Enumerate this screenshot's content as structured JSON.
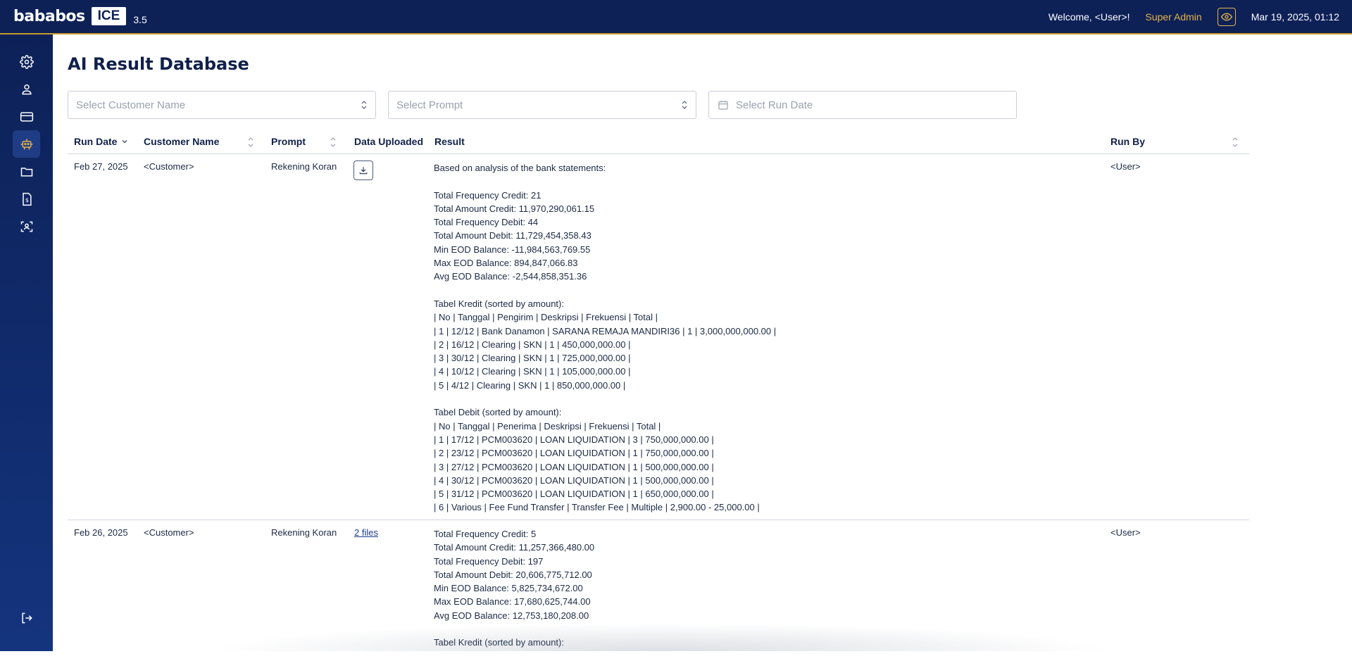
{
  "app": {
    "logo_text": "bababos",
    "logo_badge": "ICE",
    "version": "3.5",
    "welcome": "Welcome, <User>!",
    "role": "Super Admin",
    "datetime": "Mar 19, 2025, 01:12"
  },
  "sidebar": {
    "items": [
      {
        "icon": "settings-icon",
        "active": false
      },
      {
        "icon": "user-icon",
        "active": false
      },
      {
        "icon": "credit-card-icon",
        "active": false
      },
      {
        "icon": "robot-icon",
        "active": true
      },
      {
        "icon": "folder-icon",
        "active": false
      },
      {
        "icon": "dollar-document-icon",
        "active": false
      },
      {
        "icon": "face-scan-icon",
        "active": false
      }
    ],
    "logout_icon": "logout-icon"
  },
  "page": {
    "title": "AI Result Database"
  },
  "filters": {
    "customer_placeholder": "Select Customer Name",
    "prompt_placeholder": "Select Prompt",
    "run_date_placeholder": "Select Run Date"
  },
  "table": {
    "headers": {
      "run_date": "Run Date",
      "customer_name": "Customer Name",
      "prompt": "Prompt",
      "data_uploaded": "Data Uploaded",
      "result": "Result",
      "run_by": "Run By"
    },
    "rows": [
      {
        "run_date": "Feb 27, 2025",
        "customer": "<Customer>",
        "prompt": "Rekening Koran",
        "data_uploaded": "",
        "result": "Based on analysis of the bank statements:\n\nTotal Frequency Credit: 21\nTotal Amount Credit: 11,970,290,061.15\nTotal Frequency Debit: 44\nTotal Amount Debit: 11,729,454,358.43\nMin EOD Balance: -11,984,563,769.55\nMax EOD Balance: 894,847,066.83\nAvg EOD Balance: -2,544,858,351.36\n\nTabel Kredit (sorted by amount):\n| No | Tanggal | Pengirim | Deskripsi | Frekuensi | Total |\n| 1 | 12/12 | Bank Danamon | SARANA REMAJA MANDIRI36 | 1 | 3,000,000,000.00 |\n| 2 | 16/12 | Clearing | SKN | 1 | 450,000,000.00 |\n| 3 | 30/12 | Clearing | SKN | 1 | 725,000,000.00 |\n| 4 | 10/12 | Clearing | SKN | 1 | 105,000,000.00 |\n| 5 | 4/12 | Clearing | SKN | 1 | 850,000,000.00 |\n\nTabel Debit (sorted by amount):\n| No | Tanggal | Penerima | Deskripsi | Frekuensi | Total |\n| 1 | 17/12 | PCM003620 | LOAN LIQUIDATION | 3 | 750,000,000.00 |\n| 2 | 23/12 | PCM003620 | LOAN LIQUIDATION | 1 | 750,000,000.00 |\n| 3 | 27/12 | PCM003620 | LOAN LIQUIDATION | 1 | 500,000,000.00 |\n| 4 | 30/12 | PCM003620 | LOAN LIQUIDATION | 1 | 500,000,000.00 |\n| 5 | 31/12 | PCM003620 | LOAN LIQUIDATION | 1 | 650,000,000.00 |\n| 6 | Various | Fee Fund Transfer | Transfer Fee | Multiple | 2,900.00 - 25,000.00 |",
        "run_by": "<User>"
      },
      {
        "run_date": "Feb 26, 2025",
        "customer": "<Customer>",
        "prompt": "Rekening Koran",
        "data_uploaded": "2 files",
        "result": "Total Frequency Credit: 5\nTotal Amount Credit: 11,257,366,480.00\nTotal Frequency Debit: 197\nTotal Amount Debit: 20,606,775,712.00\nMin EOD Balance: 5,825,734,672.00\nMax EOD Balance: 17,680,625,744.00\nAvg EOD Balance: 12,753,180,208.00\n\nTabel Kredit (sorted by amount):",
        "run_by": "<User>"
      }
    ]
  }
}
